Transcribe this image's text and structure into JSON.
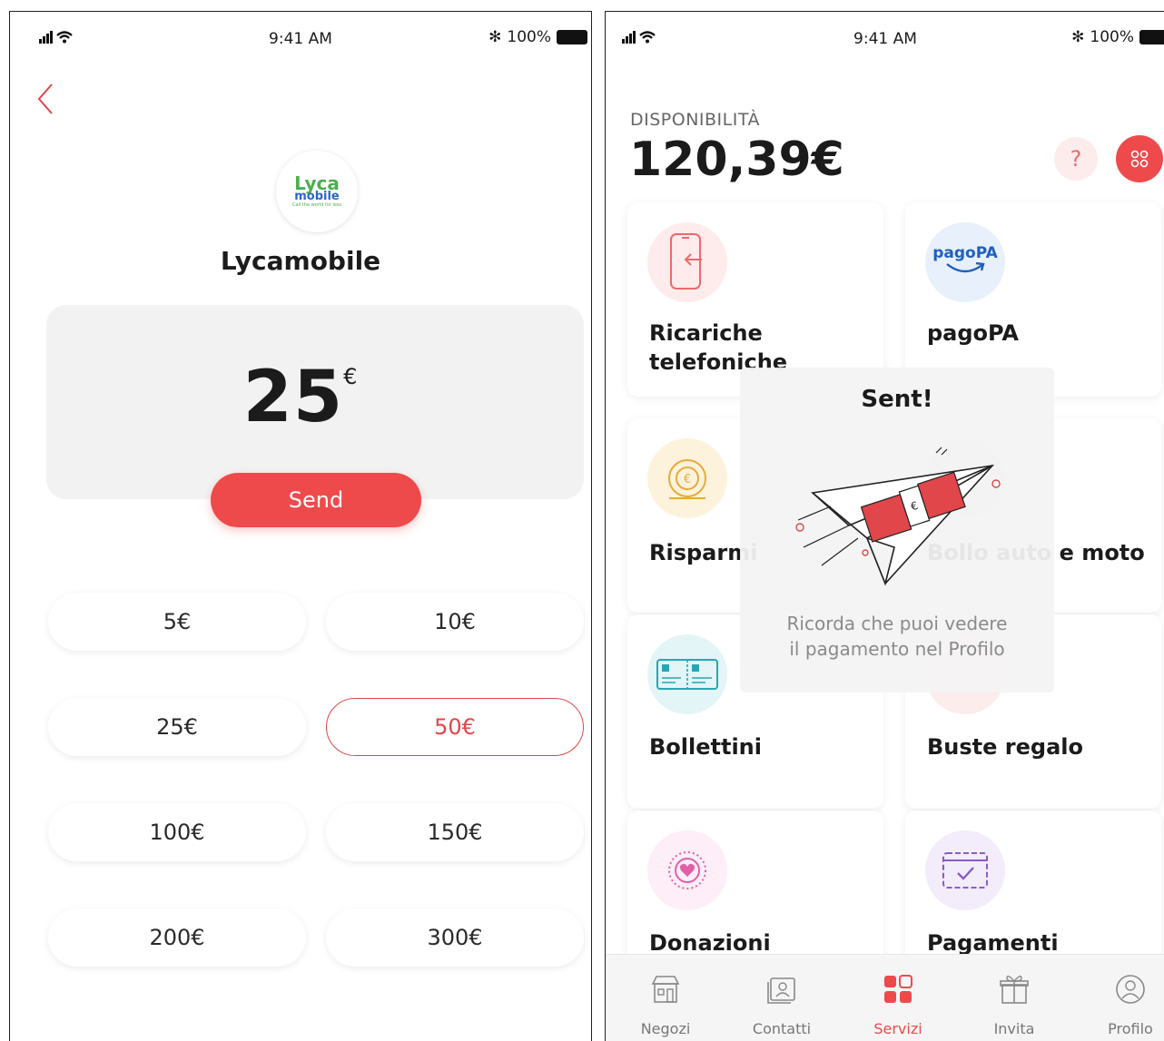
{
  "left_screen": {
    "status": {
      "time": "9:41 AM",
      "battery": "100%"
    },
    "operator": {
      "logo_line1": "Lyca",
      "logo_line2": "mobile",
      "logo_line3": "Call the world for less",
      "name": "Lycamobile"
    },
    "amount": {
      "value": "25",
      "currency": "€"
    },
    "send_label": "Send",
    "options": [
      {
        "label": "5€",
        "selected": false
      },
      {
        "label": "10€",
        "selected": false
      },
      {
        "label": "25€",
        "selected": false
      },
      {
        "label": "50€",
        "selected": true
      },
      {
        "label": "100€",
        "selected": false
      },
      {
        "label": "150€",
        "selected": false
      },
      {
        "label": "200€",
        "selected": false
      },
      {
        "label": "300€",
        "selected": false
      }
    ],
    "accent_color": "#ee4a4c"
  },
  "right_screen": {
    "status": {
      "time": "9:41 AM",
      "battery": "100%"
    },
    "balance": {
      "label": "DISPONIBILITÀ",
      "value": "120,39€"
    },
    "help_label": "?",
    "services": [
      {
        "label": "Ricariche telefoniche",
        "icon": "phone-recharge-icon"
      },
      {
        "label": "pagoPA",
        "icon": "pagopa-icon",
        "icon_text": "pagoPA"
      },
      {
        "label": "Risparmi",
        "icon": "euro-coin-icon"
      },
      {
        "label": "Bollo auto e moto",
        "icon": "car-tax-icon"
      },
      {
        "label": "Bollettini",
        "icon": "bill-slip-icon"
      },
      {
        "label": "Buste regalo",
        "icon": "gift-envelope-icon"
      },
      {
        "label": "Donazioni",
        "icon": "heart-donation-icon"
      },
      {
        "label": "Pagamenti",
        "icon": "calendar-check-icon"
      }
    ],
    "overlay": {
      "title": "Sent!",
      "message_line1": "Ricorda che puoi vedere",
      "message_line2": "il pagamento nel Profilo"
    },
    "tabs": [
      {
        "label": "Negozi",
        "icon": "store-icon",
        "active": false
      },
      {
        "label": "Contatti",
        "icon": "contacts-icon",
        "active": false
      },
      {
        "label": "Servizi",
        "icon": "services-grid-icon",
        "active": true
      },
      {
        "label": "Invita",
        "icon": "gift-icon",
        "active": false
      },
      {
        "label": "Profilo",
        "icon": "profile-icon",
        "active": false
      }
    ]
  }
}
